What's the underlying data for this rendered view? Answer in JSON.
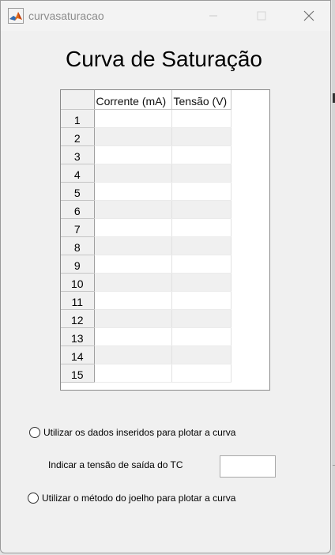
{
  "window": {
    "title": "curvasaturacao"
  },
  "main": {
    "title": "Curva de Saturação"
  },
  "table": {
    "columns": [
      "Corrente (mA)",
      "Tensão (V)"
    ],
    "rows": [
      {
        "label": "1",
        "values": [
          "",
          ""
        ]
      },
      {
        "label": "2",
        "values": [
          "",
          ""
        ]
      },
      {
        "label": "3",
        "values": [
          "",
          ""
        ]
      },
      {
        "label": "4",
        "values": [
          "",
          ""
        ]
      },
      {
        "label": "5",
        "values": [
          "",
          ""
        ]
      },
      {
        "label": "6",
        "values": [
          "",
          ""
        ]
      },
      {
        "label": "7",
        "values": [
          "",
          ""
        ]
      },
      {
        "label": "8",
        "values": [
          "",
          ""
        ]
      },
      {
        "label": "9",
        "values": [
          "",
          ""
        ]
      },
      {
        "label": "10",
        "values": [
          "",
          ""
        ]
      },
      {
        "label": "11",
        "values": [
          "",
          ""
        ]
      },
      {
        "label": "12",
        "values": [
          "",
          ""
        ]
      },
      {
        "label": "13",
        "values": [
          "",
          ""
        ]
      },
      {
        "label": "14",
        "values": [
          "",
          ""
        ]
      },
      {
        "label": "15",
        "values": [
          "",
          ""
        ]
      }
    ]
  },
  "options": {
    "use_data_label": "Utilizar os dados inseridos para plotar a curva",
    "tc_voltage_label": "Indicar a tensão de saída do TC",
    "tc_voltage_value": "",
    "knee_method_label": "Utilizar o método do joelho para plotar a curva"
  }
}
